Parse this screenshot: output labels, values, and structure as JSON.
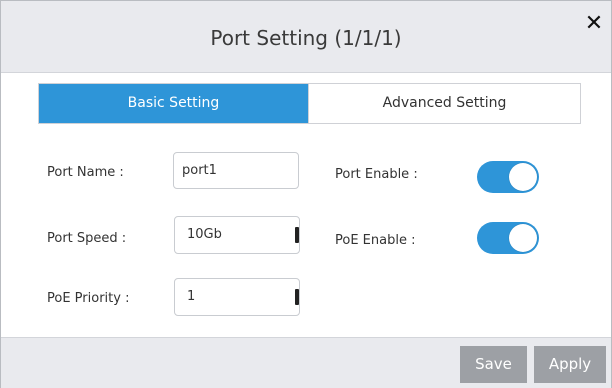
{
  "dialog": {
    "title": "Port Setting (1/1/1)",
    "close_glyph": "✕",
    "close_icon": "close-icon"
  },
  "tabs": [
    {
      "label": "Basic Setting",
      "active": true
    },
    {
      "label": "Advanced Setting",
      "active": false
    }
  ],
  "form": {
    "port_name": {
      "label": "Port Name :",
      "value": "port1"
    },
    "port_speed": {
      "label": "Port Speed :",
      "value": "10Gb"
    },
    "poe_priority": {
      "label": "PoE Priority :",
      "value": "1"
    },
    "port_enable": {
      "label": "Port Enable :",
      "on": true
    },
    "poe_enable": {
      "label": "PoE Enable :",
      "on": true
    }
  },
  "footer": {
    "save_label": "Save",
    "apply_label": "Apply"
  },
  "colors": {
    "accent": "#2e95d8",
    "header_bg": "#e9eaee",
    "button_bg": "#9da0a5"
  }
}
